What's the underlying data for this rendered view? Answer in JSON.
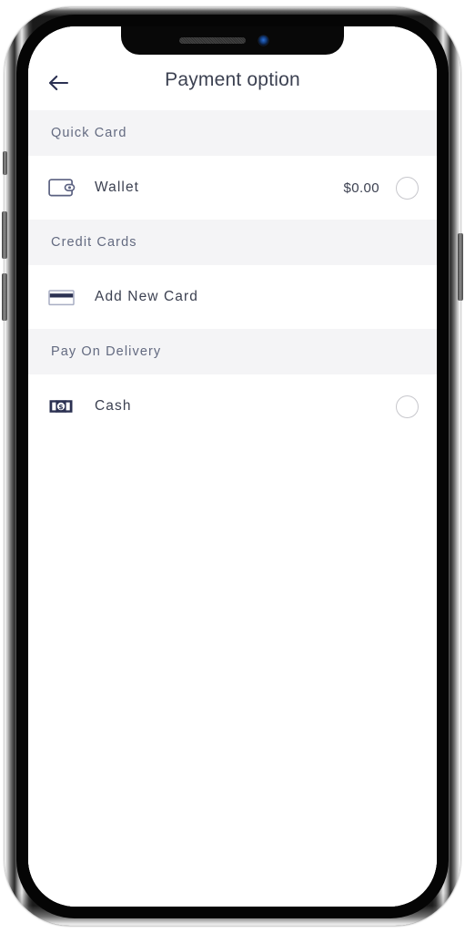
{
  "device": {
    "type": "smartphone-mockup",
    "notch": {
      "speaker_icon": "speaker-grille-icon",
      "camera_icon": "front-camera-icon"
    },
    "buttons": {
      "silent_switch": "silent-switch",
      "volume_up": "volume-up-button",
      "volume_down": "volume-down-button",
      "power": "power-button"
    }
  },
  "header": {
    "back_icon": "arrow-left-icon",
    "title": "Payment option"
  },
  "colors": {
    "text_primary": "#3c4151",
    "text_muted": "#636a80",
    "section_band": "#f4f4f6",
    "icon_navy": "#2b3152",
    "radio_border": "#c7c7cc",
    "screen_bg": "#ffffff"
  },
  "sections": [
    {
      "title": "Quick Card",
      "rows": [
        {
          "icon": "wallet-icon",
          "label": "Wallet",
          "amount": "$0.00",
          "has_radio": true,
          "selected": false
        }
      ]
    },
    {
      "title": "Credit Cards",
      "rows": [
        {
          "icon": "credit-card-icon",
          "label": "Add New Card",
          "amount": "",
          "has_radio": false,
          "selected": false
        }
      ]
    },
    {
      "title": "Pay On Delivery",
      "rows": [
        {
          "icon": "cash-banknote-icon",
          "label": "Cash",
          "amount": "",
          "has_radio": true,
          "selected": false
        }
      ]
    }
  ]
}
